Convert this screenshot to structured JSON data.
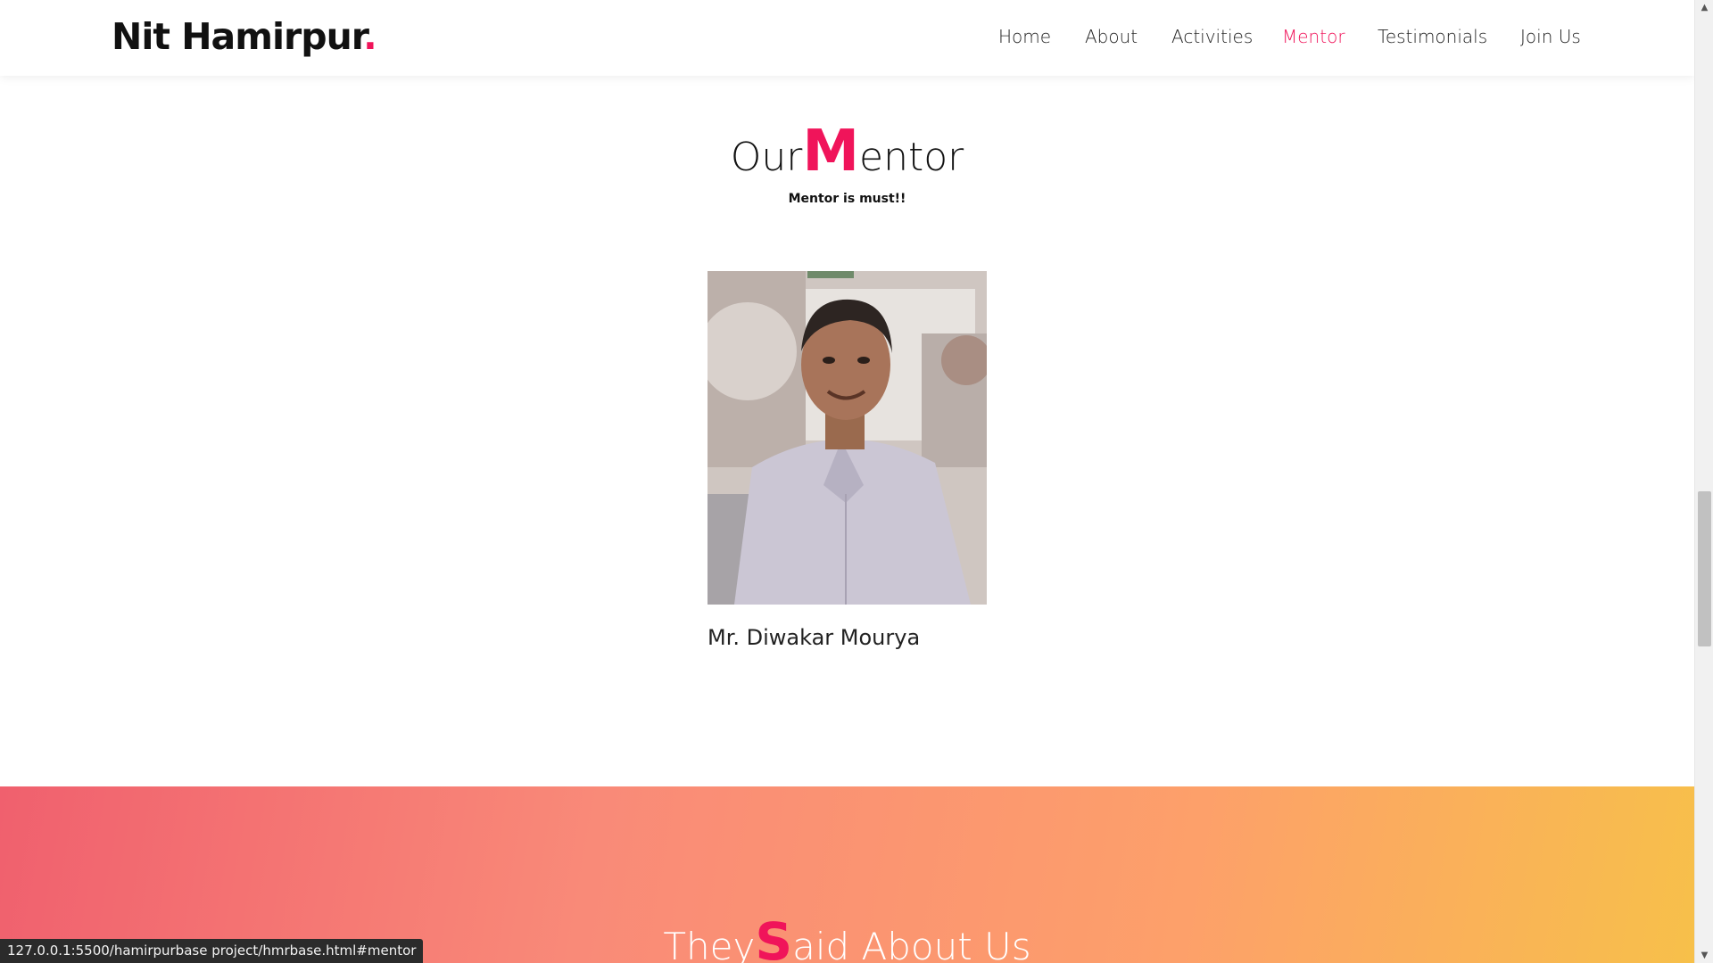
{
  "header": {
    "logo_text": "Nit Hamirpur",
    "logo_dot": ".",
    "nav": [
      {
        "label": "Home"
      },
      {
        "label": "About"
      },
      {
        "label": "Activities"
      },
      {
        "label": "Mentor",
        "active": true
      },
      {
        "label": "Testimonials"
      },
      {
        "label": "Join Us"
      }
    ]
  },
  "mentor": {
    "title_prefix": "Our",
    "title_big": "M",
    "title_rest": "entor",
    "subtitle": "Mentor is must!!",
    "name": "Mr. Diwakar Mourya"
  },
  "testimonials": {
    "title_prefix": "They",
    "title_big": "S",
    "title_rest": "aid About Us"
  },
  "status_bar": {
    "url": "127.0.0.1:5500/hamirpurbase project/hmrbase.html#mentor"
  },
  "colors": {
    "accent": "#f0145a",
    "band_start": "#f0606e",
    "band_end": "#f7c04a"
  }
}
